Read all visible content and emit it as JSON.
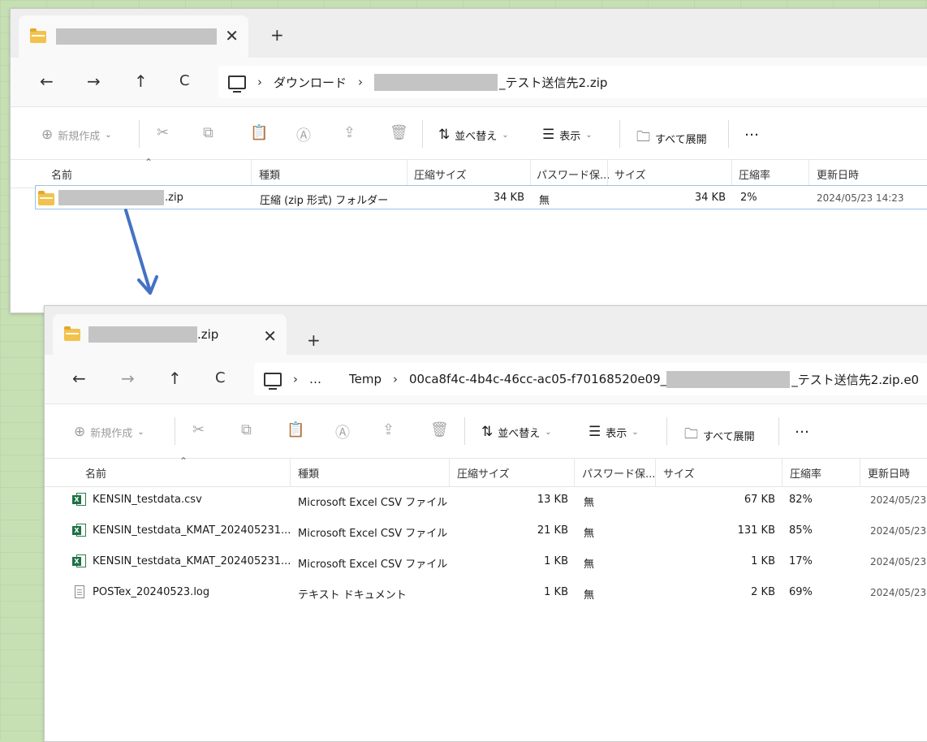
{
  "window1": {
    "tab_suffix": "",
    "nav": {
      "back": "←",
      "forward": "→",
      "up": "↑",
      "refresh": "C"
    },
    "breadcrumb": [
      "ダウンロード"
    ],
    "zip_suffix": "_テスト送信先2.zip",
    "toolbar": {
      "new_label": "新規作成",
      "sort_label": "並べ替え",
      "view_label": "表示",
      "extract_label": "すべて展開",
      "more": "…"
    },
    "columns": [
      "名前",
      "種類",
      "圧縮サイズ",
      "パスワード保...",
      "サイズ",
      "圧縮率",
      "更新日時"
    ],
    "rows": [
      {
        "name_suffix": ".zip",
        "type": "圧縮 (zip 形式) フォルダー",
        "compressed": "34 KB",
        "password": "無",
        "size": "34 KB",
        "ratio": "2%",
        "date": "2024/05/23 14:23"
      }
    ]
  },
  "window2": {
    "tab_suffix": ".zip",
    "nav": {
      "back": "←",
      "forward": "→",
      "up": "↑",
      "refresh": "C"
    },
    "breadcrumb_more": "…",
    "breadcrumb": [
      "Temp",
      "00ca8f4c-4b4c-46cc-ac05-f70168520e09_"
    ],
    "path_suffix": "_テスト送信先2.zip.e0",
    "toolbar": {
      "new_label": "新規作成",
      "sort_label": "並べ替え",
      "view_label": "表示",
      "extract_label": "すべて展開",
      "more": "…"
    },
    "columns": [
      "名前",
      "種類",
      "圧縮サイズ",
      "パスワード保...",
      "サイズ",
      "圧縮率",
      "更新日時"
    ],
    "rows": [
      {
        "icon": "excel",
        "name": "KENSIN_testdata.csv",
        "type": "Microsoft Excel CSV ファイル",
        "compressed": "13 KB",
        "password": "無",
        "size": "67 KB",
        "ratio": "82%",
        "date": "2024/05/23"
      },
      {
        "icon": "excel",
        "name": "KENSIN_testdata_KMAT_202405231...",
        "type": "Microsoft Excel CSV ファイル",
        "compressed": "21 KB",
        "password": "無",
        "size": "131 KB",
        "ratio": "85%",
        "date": "2024/05/23"
      },
      {
        "icon": "excel",
        "name": "KENSIN_testdata_KMAT_202405231...",
        "type": "Microsoft Excel CSV ファイル",
        "compressed": "1 KB",
        "password": "無",
        "size": "1 KB",
        "ratio": "17%",
        "date": "2024/05/23"
      },
      {
        "icon": "text",
        "name": "POSTex_20240523.log",
        "type": "テキスト ドキュメント",
        "compressed": "1 KB",
        "password": "無",
        "size": "2 KB",
        "ratio": "69%",
        "date": "2024/05/23"
      }
    ]
  },
  "colors": {
    "background": "#c6e0b4",
    "arrow": "#4472c4",
    "selection": "#9cc3e8"
  }
}
